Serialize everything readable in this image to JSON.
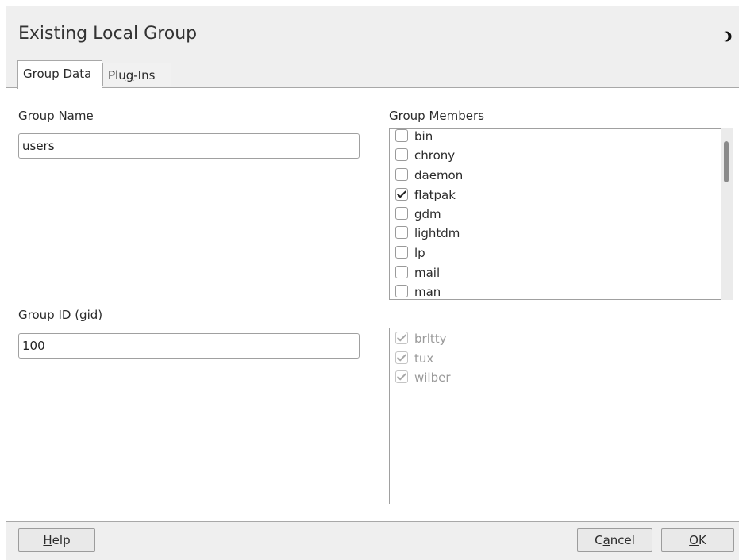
{
  "window": {
    "title": "Existing Local Group",
    "title_icon": "half-moon-icon"
  },
  "tabs": [
    {
      "pre": "Group ",
      "mnemonic": "D",
      "post": "ata",
      "active": true
    },
    {
      "pre": "Plu",
      "mnemonic": "g",
      "post": "-Ins",
      "active": false
    }
  ],
  "group_name": {
    "label_pre": "Group ",
    "label_mnemonic": "N",
    "label_post": "ame",
    "value": "users"
  },
  "group_id": {
    "label_pre": "Group ",
    "label_mnemonic": "I",
    "label_post": "D (gid)",
    "value": "100"
  },
  "group_members": {
    "label_pre": "Group ",
    "label_mnemonic": "M",
    "label_post": "embers",
    "items": [
      {
        "name": "bin",
        "checked": false
      },
      {
        "name": "chrony",
        "checked": false
      },
      {
        "name": "daemon",
        "checked": false
      },
      {
        "name": "flatpak",
        "checked": true
      },
      {
        "name": "gdm",
        "checked": false
      },
      {
        "name": "lightdm",
        "checked": false
      },
      {
        "name": "lp",
        "checked": false
      },
      {
        "name": "mail",
        "checked": false
      },
      {
        "name": "man",
        "checked": false
      }
    ]
  },
  "fixed_members": {
    "items": [
      {
        "name": "brltty",
        "checked": true
      },
      {
        "name": "tux",
        "checked": true
      },
      {
        "name": "wilber",
        "checked": true
      }
    ]
  },
  "buttons": {
    "help": {
      "mnemonic": "H",
      "post": "elp"
    },
    "cancel": {
      "pre": "C",
      "mnemonic": "a",
      "post": "ncel"
    },
    "ok": {
      "mnemonic": "O",
      "post": "K"
    }
  }
}
